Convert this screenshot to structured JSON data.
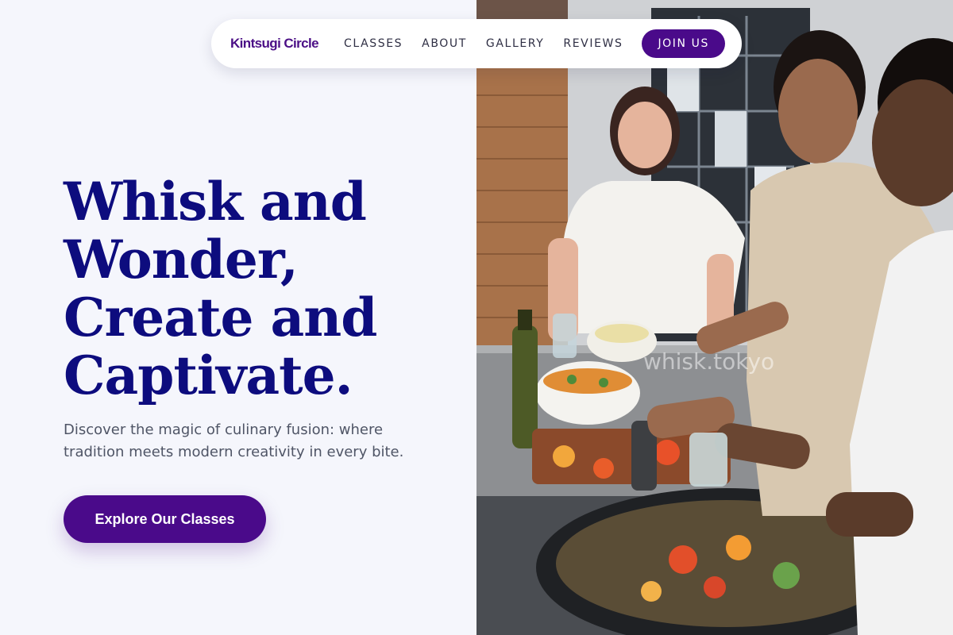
{
  "navbar": {
    "brand": "Kintsugi Circle",
    "links": [
      "CLASSES",
      "ABOUT",
      "GALLERY",
      "REVIEWS"
    ],
    "cta_label": "JOIN US"
  },
  "hero": {
    "title_lines": [
      "Whisk and",
      "Wonder,",
      "Create and",
      "Captivate."
    ],
    "subtitle": "Discover the magic of culinary fusion: where tradition meets modern creativity in every bite.",
    "cta_label": "Explore Our Classes"
  },
  "photo": {
    "watermark": "whisk.tokyo"
  },
  "colors": {
    "brand_purple": "#4a0a8a",
    "title_navy": "#0d0c7e",
    "background": "#f5f6fc"
  }
}
